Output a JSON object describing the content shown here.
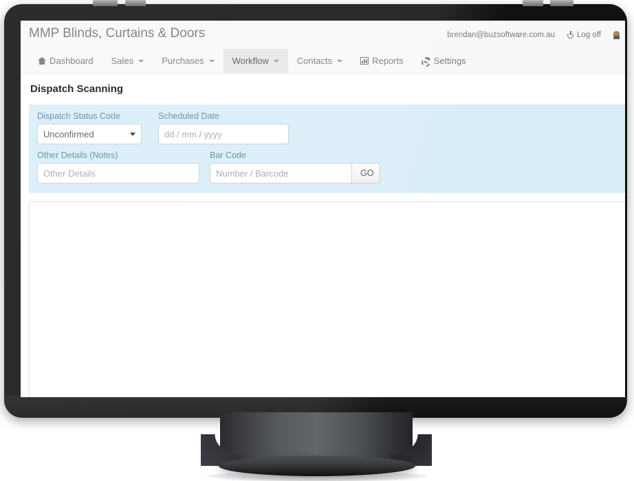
{
  "brand": {
    "title": "MMP Blinds, Curtains & Doors"
  },
  "account": {
    "email": "brendan@buzsoftware.com.au",
    "logoff_label": "Log off",
    "power_icon": "power-icon",
    "user_icon": "user-avatar-icon"
  },
  "nav": {
    "items": [
      {
        "label": "Dashboard",
        "icon": "home-icon",
        "caret": false,
        "active": false
      },
      {
        "label": "Sales",
        "icon": "",
        "caret": true,
        "active": false
      },
      {
        "label": "Purchases",
        "icon": "",
        "caret": true,
        "active": false
      },
      {
        "label": "Workflow",
        "icon": "",
        "caret": true,
        "active": true
      },
      {
        "label": "Contacts",
        "icon": "",
        "caret": true,
        "active": false
      },
      {
        "label": "Reports",
        "icon": "chart-icon",
        "caret": false,
        "active": false
      },
      {
        "label": "Settings",
        "icon": "cogs-icon",
        "caret": false,
        "active": false
      }
    ]
  },
  "page": {
    "heading": "Dispatch Scanning"
  },
  "form": {
    "status": {
      "label": "Dispatch Status Code",
      "value": "Unconfirmed",
      "options": [
        "Unconfirmed"
      ]
    },
    "scheduled_date": {
      "label": "Scheduled Date",
      "value": "",
      "placeholder": "dd / mm / yyyy"
    },
    "other_details": {
      "label": "Other Details (Notes)",
      "value": "",
      "placeholder": "Other Details"
    },
    "barcode": {
      "label": "Bar Code",
      "value": "",
      "placeholder": "Number / Barcode",
      "go_label": "GO"
    }
  },
  "results": {
    "rows": []
  },
  "colors": {
    "panel_info_bg": "#d9edf7",
    "label_blue": "#5a8ba8",
    "navbar_bg": "#f8f8f8",
    "nav_active_bg": "#e7e7e7",
    "bezel": "#111111"
  }
}
